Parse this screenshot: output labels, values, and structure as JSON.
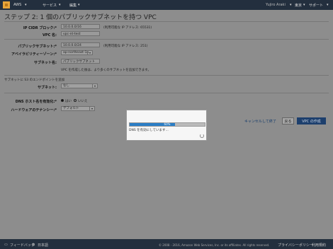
{
  "topbar": {
    "aws": "AWS",
    "services": "サービス",
    "edit": "編集",
    "user": "Yujiro Araki",
    "region": "東京",
    "support": "サポート"
  },
  "page": {
    "title": "ステップ 2: 1 個のパブリックサブネットを持つ VPC"
  },
  "form": {
    "ipv4_cidr_label": "IP CIDR ブロック:*",
    "ipv4_cidr_value": "10.0.0.0/16",
    "ipv4_cidr_note": "(利用可能な IP アドレス: 65531)",
    "vpc_name_label": "VPC 名:",
    "vpc_name_value": "vpc-nt-test",
    "public_subnet_label": "パブリックサブネット:*",
    "public_subnet_value": "10.0.0.0/24",
    "public_subnet_note": "(利用可能な IP アドレス: 251)",
    "az_label": "アベイラビリティーゾーン:*",
    "az_value": "ap-northeast-1a",
    "subnet_name_label": "サブネット名:",
    "subnet_name_value": "パブリックサブネット",
    "subnet_hint": "VPC を作成した後は、より多くのサブネットを追加できます。",
    "s3_section": "サブネットに S3 のエンドポイントを追加",
    "s3_subnet_label": "サブネット:",
    "s3_subnet_value": "なし",
    "dns_label": "DNS ホスト名を有効化:*",
    "dns_yes": "はい",
    "dns_no": "いいえ",
    "tenancy_label": "ハードウェアのテナンシー:*",
    "tenancy_value": "デフォルト"
  },
  "buttons": {
    "cancel": "キャンセルして終了",
    "back": "戻る",
    "create": "VPC の作成"
  },
  "modal": {
    "progress": 0.6,
    "progress_label": "60%",
    "message": "DNS を有効にしています..."
  },
  "footer": {
    "feedback": "フィードバック",
    "language": "日本語",
    "copyright": "© 2008 - 2016, Amazon Web Services, Inc. or its affiliates. All rights reserved.",
    "privacy": "プライバシーポリシー",
    "terms": "利用規約"
  }
}
